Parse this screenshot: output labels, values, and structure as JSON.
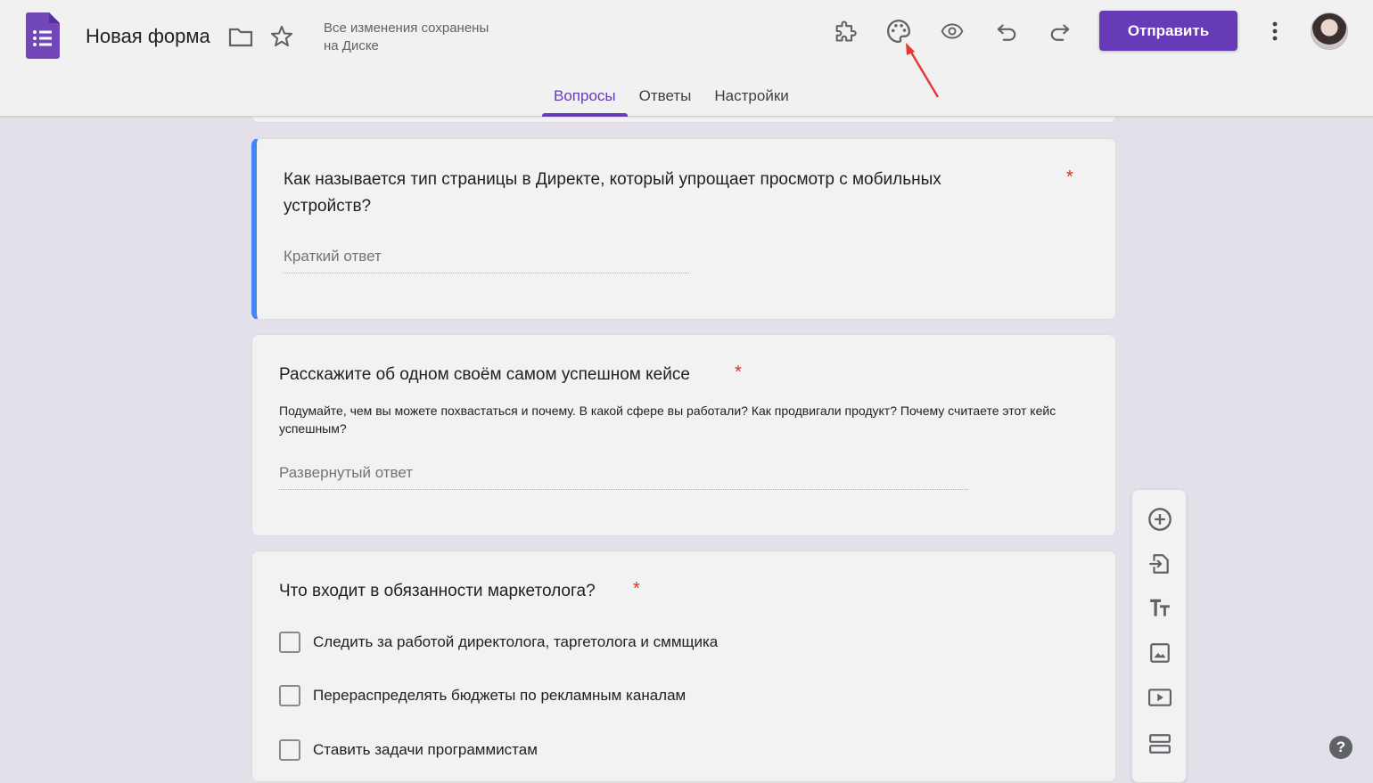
{
  "header": {
    "form_title": "Новая форма",
    "save_status_line1": "Все изменения сохранены",
    "save_status_line2": "на Диске",
    "send_label": "Отправить",
    "icons": [
      "forms-logo-icon",
      "folder-icon",
      "star-icon",
      "addon-puzzle-icon",
      "palette-icon",
      "eye-preview-icon",
      "undo-icon",
      "redo-icon",
      "more-vert-icon"
    ]
  },
  "tabs": [
    {
      "label": "Вопросы",
      "active": true
    },
    {
      "label": "Ответы",
      "active": false
    },
    {
      "label": "Настройки",
      "active": false
    }
  ],
  "questions": [
    {
      "title": "Как называется тип страницы в Директе, который упрощает просмотр с мобильных устройств?",
      "required_mark": "*",
      "answer_placeholder": "Краткий ответ"
    },
    {
      "title": "Расскажите об одном своём самом успешном кейсе",
      "required_mark": "*",
      "description": "Подумайте, чем вы можете похвастаться и почему. В какой сфере вы работали? Как продвигали продукт? Почему считаете этот кейс успешным?",
      "answer_placeholder": "Развернутый ответ"
    },
    {
      "title": "Что входит в обязанности маркетолога?",
      "required_mark": "*",
      "options": [
        "Следить за работой директолога, таргетолога и сммщика",
        "Перераспределять бюджеты по рекламным каналам",
        "Ставить задачи программистам"
      ]
    }
  ],
  "side_toolbar": [
    "add-question-icon",
    "import-questions-icon",
    "add-title-icon",
    "add-image-icon",
    "add-video-icon",
    "add-section-icon"
  ],
  "help_label": "?",
  "colors": {
    "accent": "#673ab7",
    "active_border": "#4285f4",
    "required": "#d93025",
    "annotation_arrow": "#e53935"
  }
}
